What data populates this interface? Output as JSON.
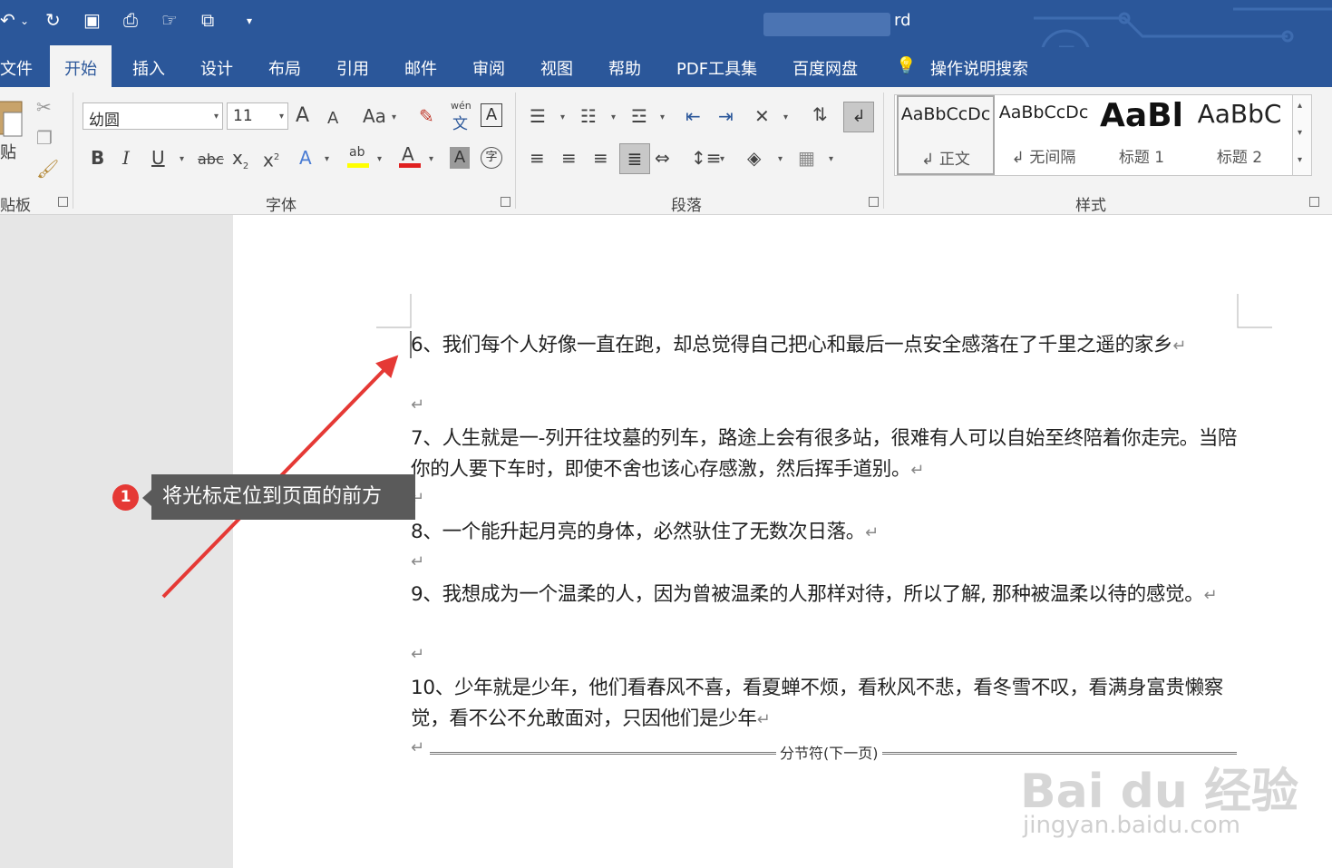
{
  "window": {
    "title_suffix": "rd"
  },
  "quick_access": [
    "undo-icon",
    "redo-icon",
    "save-icon",
    "print-preview-icon",
    "touch-mode-icon",
    "customize-icon"
  ],
  "tabs": [
    {
      "label": "文件"
    },
    {
      "label": "开始",
      "active": true
    },
    {
      "label": "插入"
    },
    {
      "label": "设计"
    },
    {
      "label": "布局"
    },
    {
      "label": "引用"
    },
    {
      "label": "邮件"
    },
    {
      "label": "审阅"
    },
    {
      "label": "视图"
    },
    {
      "label": "帮助"
    },
    {
      "label": "PDF工具集"
    },
    {
      "label": "百度网盘"
    }
  ],
  "tell_me": "操作说明搜索",
  "ribbon": {
    "clipboard": {
      "label": "剪贴板",
      "paste_label": "粘贴"
    },
    "font": {
      "label": "字体",
      "font_name": "幼圆",
      "font_size": "11",
      "grow": "A",
      "shrink": "A",
      "case": "Aa",
      "bold": "B",
      "italic": "I",
      "underline": "U",
      "strike": "abc",
      "sub": "x",
      "sup": "x",
      "phonetic": "wén",
      "phonetic_char": "文"
    },
    "paragraph": {
      "label": "段落"
    },
    "styles": {
      "label": "样式",
      "items": [
        {
          "preview": "AaBbCcDc",
          "name": "↲ 正文"
        },
        {
          "preview": "AaBbCcDc",
          "name": "↲ 无间隔"
        },
        {
          "preview": "AaBl",
          "name": "标题 1"
        },
        {
          "preview": "AaBbC",
          "name": "标题 2"
        }
      ]
    }
  },
  "document": {
    "paragraphs": [
      {
        "text": "6、我们每个人好像一直在跑，却总觉得自己把心和最后一点安全感落在了千里之遥的家乡"
      },
      {
        "text": "7、人生就是一-列开往坟墓的列车，路途上会有很多站，很难有人可以自始至终陪着你走完。当陪你的人要下车时，即使不舍也该心存感激，然后挥手道别。"
      },
      {
        "text": "8、一个能升起月亮的身体，必然驮住了无数次日落。"
      },
      {
        "text": "9、我想成为一个温柔的人，因为曾被温柔的人那样对待，所以了解, 那种被温柔以待的感觉。"
      },
      {
        "text": "10、少年就是少年，他们看春风不喜，看夏蝉不烦，看秋风不悲，看冬雪不叹，看满身富贵懒察觉，看不公不允敢面对，只因他们是少年"
      }
    ],
    "paragraph_mark": "↵",
    "section_break": "分节符(下一页)"
  },
  "callout": {
    "number": "1",
    "text": "将光标定位到页面的前方"
  },
  "watermark": {
    "logo": "Bai du 经验",
    "url": "jingyan.baidu.com"
  },
  "colors": {
    "title_bar": "#2b579a",
    "ribbon": "#f3f3f3",
    "callout_badge": "#e53935",
    "arrow": "#e53935"
  }
}
